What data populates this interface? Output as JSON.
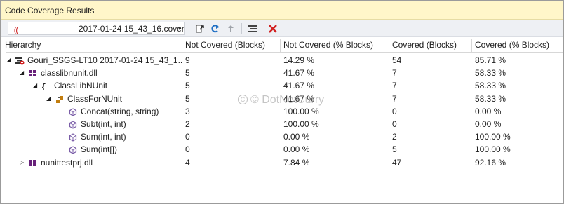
{
  "window": {
    "title": "Code Coverage Results"
  },
  "toolbar": {
    "result_prefix": "⸨",
    "result_value": "2017-01-24 15_43_16.cover",
    "buttons": [
      {
        "name": "import-results-icon"
      },
      {
        "name": "refresh-icon"
      },
      {
        "name": "export-results-icon"
      },
      {
        "name": "show-coloring-icon"
      },
      {
        "name": "remove-result-icon"
      }
    ]
  },
  "columns": [
    "Hierarchy",
    "Not Covered (Blocks)",
    "Not Covered (% Blocks)",
    "Covered (Blocks)",
    "Covered (% Blocks)"
  ],
  "rows": [
    {
      "name": "Gouri_SSGS-LT10 2017-01-24 15_43_1...",
      "icon": "coverage-result-icon",
      "expander": "◢",
      "not_blocks": "9",
      "not_pct": "14.29 %",
      "cov_blocks": "54",
      "cov_pct": "85.71 %"
    },
    {
      "name": "classlibnunit.dll",
      "icon": "assembly-icon",
      "expander": "◢",
      "not_blocks": "5",
      "not_pct": "41.67 %",
      "cov_blocks": "7",
      "cov_pct": "58.33 %"
    },
    {
      "name": "ClassLibNUnit",
      "icon": "namespace-icon",
      "expander": "◢",
      "not_blocks": "5",
      "not_pct": "41.67 %",
      "cov_blocks": "7",
      "cov_pct": "58.33 %"
    },
    {
      "name": "ClassForNUnit",
      "icon": "class-icon",
      "expander": "◢",
      "not_blocks": "5",
      "not_pct": "41.67 %",
      "cov_blocks": "7",
      "cov_pct": "58.33 %"
    },
    {
      "name": "Concat(string, string)",
      "icon": "method-icon",
      "expander": "",
      "not_blocks": "3",
      "not_pct": "100.00 %",
      "cov_blocks": "0",
      "cov_pct": "0.00 %"
    },
    {
      "name": "Subt(int, int)",
      "icon": "method-icon",
      "expander": "",
      "not_blocks": "2",
      "not_pct": "100.00 %",
      "cov_blocks": "0",
      "cov_pct": "0.00 %"
    },
    {
      "name": "Sum(int, int)",
      "icon": "method-icon",
      "expander": "",
      "not_blocks": "0",
      "not_pct": "0.00 %",
      "cov_blocks": "2",
      "cov_pct": "100.00 %"
    },
    {
      "name": "Sum(int[])",
      "icon": "method-icon",
      "expander": "",
      "not_blocks": "0",
      "not_pct": "0.00 %",
      "cov_blocks": "5",
      "cov_pct": "100.00 %"
    },
    {
      "name": "nunittestprj.dll",
      "icon": "assembly-icon",
      "expander": "▷",
      "not_blocks": "4",
      "not_pct": "7.84 %",
      "cov_blocks": "47",
      "cov_pct": "92.16 %"
    }
  ],
  "watermark": {
    "text": "© DotNetCurry"
  },
  "colors": {
    "titlebar": "#fff6c9",
    "toolbar": "#eef0f4",
    "assembly": "#68217a",
    "method": "#7b5ea8",
    "remove": "#d11f1f",
    "refresh": "#1f6fc4"
  }
}
